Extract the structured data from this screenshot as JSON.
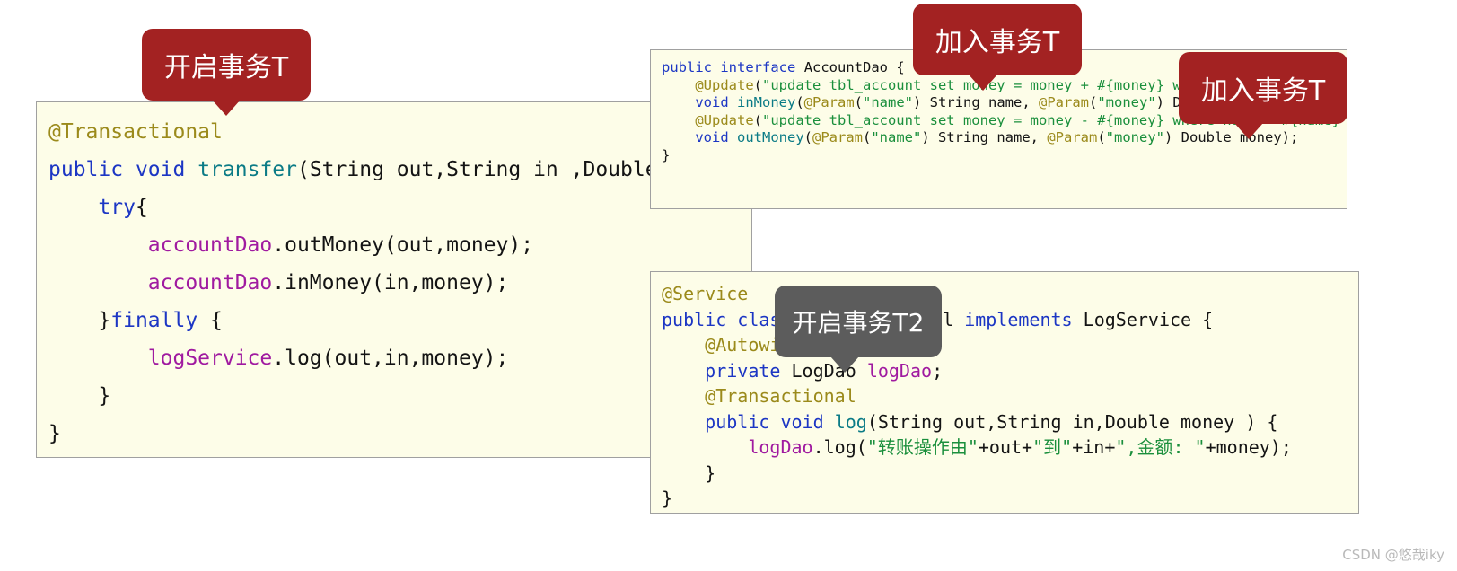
{
  "watermark": "CSDN @悠哉iky",
  "colors": {
    "code_background": "#fdfde8",
    "code_border": "#a0a0a0",
    "callout_red": "#a32222",
    "callout_gray": "#5c5c5c",
    "annotation": "#9b8a1b",
    "keyword": "#1c36c4",
    "string": "#1a8f3c",
    "field": "#a01aa0",
    "method": "#0b7b86",
    "watermark": "#b9b9b9"
  },
  "callouts": [
    {
      "id": "callout-1",
      "label": "开启事务T",
      "style": "red",
      "target": "transactional-annotation"
    },
    {
      "id": "callout-2",
      "label": "加入事务T",
      "style": "red",
      "target": "dao-inmoney-update"
    },
    {
      "id": "callout-3",
      "label": "加入事务T",
      "style": "red",
      "target": "dao-outmoney-update"
    },
    {
      "id": "callout-4",
      "label": "开启事务T2",
      "style": "gray",
      "target": "logservice-transactional"
    }
  ],
  "panels": {
    "service": {
      "name": "AccountServiceImpl transfer method",
      "lines": [
        {
          "indent": 0,
          "tokens": [
            {
              "t": "@Transactional",
              "c": "ann"
            }
          ]
        },
        {
          "indent": 0,
          "tokens": [
            {
              "t": "public",
              "c": "kw"
            },
            {
              "t": " ",
              "c": "plain"
            },
            {
              "t": "void",
              "c": "kw"
            },
            {
              "t": " ",
              "c": "plain"
            },
            {
              "t": "transfer",
              "c": "fn"
            },
            {
              "t": "(String out,String in ,Double money)",
              "c": "plain"
            }
          ]
        },
        {
          "indent": 1,
          "tokens": [
            {
              "t": "try",
              "c": "kw"
            },
            {
              "t": "{",
              "c": "plain"
            }
          ]
        },
        {
          "indent": 2,
          "tokens": [
            {
              "t": "accountDao",
              "c": "field"
            },
            {
              "t": ".outMoney(out,money);",
              "c": "plain"
            }
          ]
        },
        {
          "indent": 2,
          "tokens": [
            {
              "t": "accountDao",
              "c": "field"
            },
            {
              "t": ".inMoney(in,money);",
              "c": "plain"
            }
          ]
        },
        {
          "indent": 1,
          "tokens": [
            {
              "t": "}",
              "c": "plain"
            },
            {
              "t": "finally",
              "c": "kw"
            },
            {
              "t": " {",
              "c": "plain"
            }
          ]
        },
        {
          "indent": 2,
          "tokens": [
            {
              "t": "logService",
              "c": "field"
            },
            {
              "t": ".log(out,in,money);",
              "c": "plain"
            }
          ]
        },
        {
          "indent": 1,
          "tokens": [
            {
              "t": "}",
              "c": "plain"
            }
          ]
        },
        {
          "indent": 0,
          "tokens": [
            {
              "t": "}",
              "c": "plain"
            }
          ]
        }
      ]
    },
    "dao": {
      "name": "AccountDao interface",
      "lines": [
        {
          "indent": 0,
          "tokens": [
            {
              "t": "public",
              "c": "kw"
            },
            {
              "t": " ",
              "c": "plain"
            },
            {
              "t": "interface",
              "c": "kw"
            },
            {
              "t": " ",
              "c": "plain"
            },
            {
              "t": "AccountDao {",
              "c": "plain"
            }
          ]
        },
        {
          "indent": 0,
          "tokens": [
            {
              "t": "",
              "c": "plain"
            }
          ]
        },
        {
          "indent": 1,
          "tokens": [
            {
              "t": "@Update",
              "c": "ann"
            },
            {
              "t": "(",
              "c": "plain"
            },
            {
              "t": "\"update tbl_account set money = money + #{money} where name = #{name}\"",
              "c": "str"
            },
            {
              "t": ")",
              "c": "plain"
            }
          ]
        },
        {
          "indent": 1,
          "tokens": [
            {
              "t": "void",
              "c": "kw"
            },
            {
              "t": " ",
              "c": "plain"
            },
            {
              "t": "inMoney",
              "c": "fn"
            },
            {
              "t": "(",
              "c": "plain"
            },
            {
              "t": "@Param",
              "c": "ann"
            },
            {
              "t": "(",
              "c": "plain"
            },
            {
              "t": "\"name\"",
              "c": "str"
            },
            {
              "t": ") String name, ",
              "c": "plain"
            },
            {
              "t": "@Param",
              "c": "ann"
            },
            {
              "t": "(",
              "c": "plain"
            },
            {
              "t": "\"money\"",
              "c": "str"
            },
            {
              "t": ") Double money);",
              "c": "plain"
            }
          ]
        },
        {
          "indent": 0,
          "tokens": [
            {
              "t": "",
              "c": "plain"
            }
          ]
        },
        {
          "indent": 1,
          "tokens": [
            {
              "t": "@Update",
              "c": "ann"
            },
            {
              "t": "(",
              "c": "plain"
            },
            {
              "t": "\"update tbl_account set money = money - #{money} where name = #{name}\"",
              "c": "str"
            },
            {
              "t": ")",
              "c": "plain"
            }
          ]
        },
        {
          "indent": 1,
          "tokens": [
            {
              "t": "void",
              "c": "kw"
            },
            {
              "t": " ",
              "c": "plain"
            },
            {
              "t": "outMoney",
              "c": "fn"
            },
            {
              "t": "(",
              "c": "plain"
            },
            {
              "t": "@Param",
              "c": "ann"
            },
            {
              "t": "(",
              "c": "plain"
            },
            {
              "t": "\"name\"",
              "c": "str"
            },
            {
              "t": ") String name, ",
              "c": "plain"
            },
            {
              "t": "@Param",
              "c": "ann"
            },
            {
              "t": "(",
              "c": "plain"
            },
            {
              "t": "\"money\"",
              "c": "str"
            },
            {
              "t": ") Double money);",
              "c": "plain"
            }
          ]
        },
        {
          "indent": 0,
          "tokens": [
            {
              "t": "}",
              "c": "plain"
            }
          ]
        }
      ]
    },
    "logservice": {
      "name": "LogServiceImpl class",
      "lines": [
        {
          "indent": 0,
          "tokens": [
            {
              "t": "@Service",
              "c": "ann"
            }
          ]
        },
        {
          "indent": 0,
          "tokens": [
            {
              "t": "public",
              "c": "kw"
            },
            {
              "t": " ",
              "c": "plain"
            },
            {
              "t": "class",
              "c": "kw"
            },
            {
              "t": " ",
              "c": "plain"
            },
            {
              "t": "LogServiceImpl",
              "c": "plain"
            },
            {
              "t": " ",
              "c": "plain"
            },
            {
              "t": "implements",
              "c": "kw"
            },
            {
              "t": " ",
              "c": "plain"
            },
            {
              "t": "LogService {",
              "c": "plain"
            }
          ]
        },
        {
          "indent": 1,
          "tokens": [
            {
              "t": "@Autowired",
              "c": "ann"
            }
          ]
        },
        {
          "indent": 1,
          "tokens": [
            {
              "t": "private",
              "c": "kw"
            },
            {
              "t": " ",
              "c": "plain"
            },
            {
              "t": "LogDao",
              "c": "plain"
            },
            {
              "t": " ",
              "c": "plain"
            },
            {
              "t": "logDao",
              "c": "field"
            },
            {
              "t": ";",
              "c": "plain"
            }
          ]
        },
        {
          "indent": 1,
          "tokens": [
            {
              "t": "@Transactional",
              "c": "ann"
            }
          ]
        },
        {
          "indent": 1,
          "tokens": [
            {
              "t": "public",
              "c": "kw"
            },
            {
              "t": " ",
              "c": "plain"
            },
            {
              "t": "void",
              "c": "kw"
            },
            {
              "t": " ",
              "c": "plain"
            },
            {
              "t": "log",
              "c": "fn"
            },
            {
              "t": "(String out,String in,Double money ) {",
              "c": "plain"
            }
          ]
        },
        {
          "indent": 2,
          "tokens": [
            {
              "t": "logDao",
              "c": "field"
            },
            {
              "t": ".log(",
              "c": "plain"
            },
            {
              "t": "\"转账操作由\"",
              "c": "str"
            },
            {
              "t": "+out+",
              "c": "plain"
            },
            {
              "t": "\"到\"",
              "c": "str"
            },
            {
              "t": "+in+",
              "c": "plain"
            },
            {
              "t": "\",金额: \"",
              "c": "str"
            },
            {
              "t": "+money);",
              "c": "plain"
            }
          ]
        },
        {
          "indent": 1,
          "tokens": [
            {
              "t": "}",
              "c": "plain"
            }
          ]
        },
        {
          "indent": 0,
          "tokens": [
            {
              "t": "}",
              "c": "plain"
            }
          ]
        }
      ]
    }
  }
}
